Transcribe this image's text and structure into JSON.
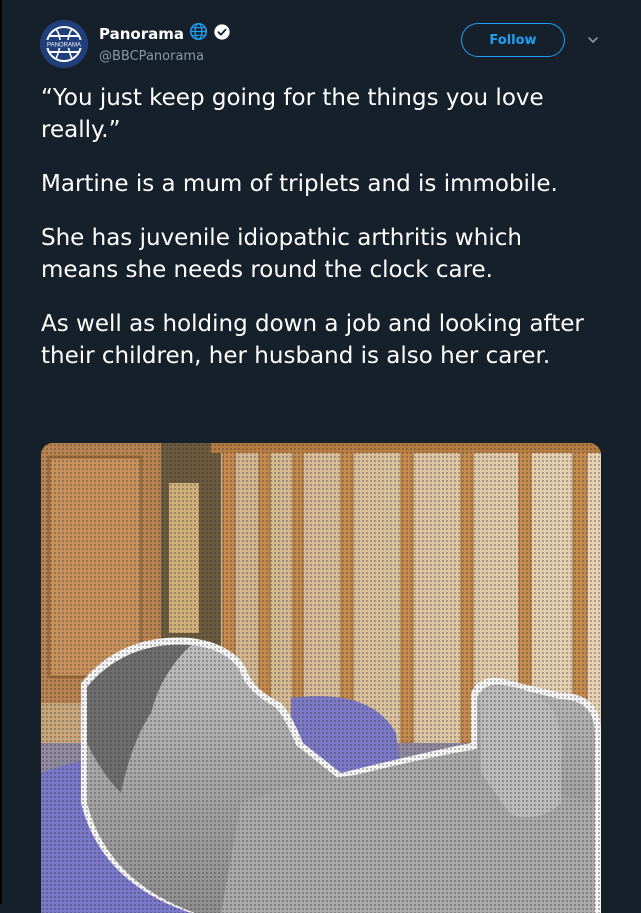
{
  "account": {
    "display_name": "Panorama",
    "handle": "@BBCPanorama",
    "avatar_text": "PANORAMA",
    "icons": {
      "globe": "globe-icon",
      "verified": "verified-badge-icon"
    }
  },
  "actions": {
    "follow_label": "Follow",
    "menu_icon": "chevron-down-icon"
  },
  "tweet": {
    "paragraphs": [
      "“You just keep going for the things you love really.”",
      "Martine is a mum of triplets and is immobile.",
      "She has juvenile idiopathic arthritis which means she needs round the clock care.",
      "As well as holding down a job and looking after their children, her husband is also her carer."
    ]
  },
  "colors": {
    "background": "#15202b",
    "accent": "#1da1f2",
    "secondary_text": "#8899a6"
  }
}
